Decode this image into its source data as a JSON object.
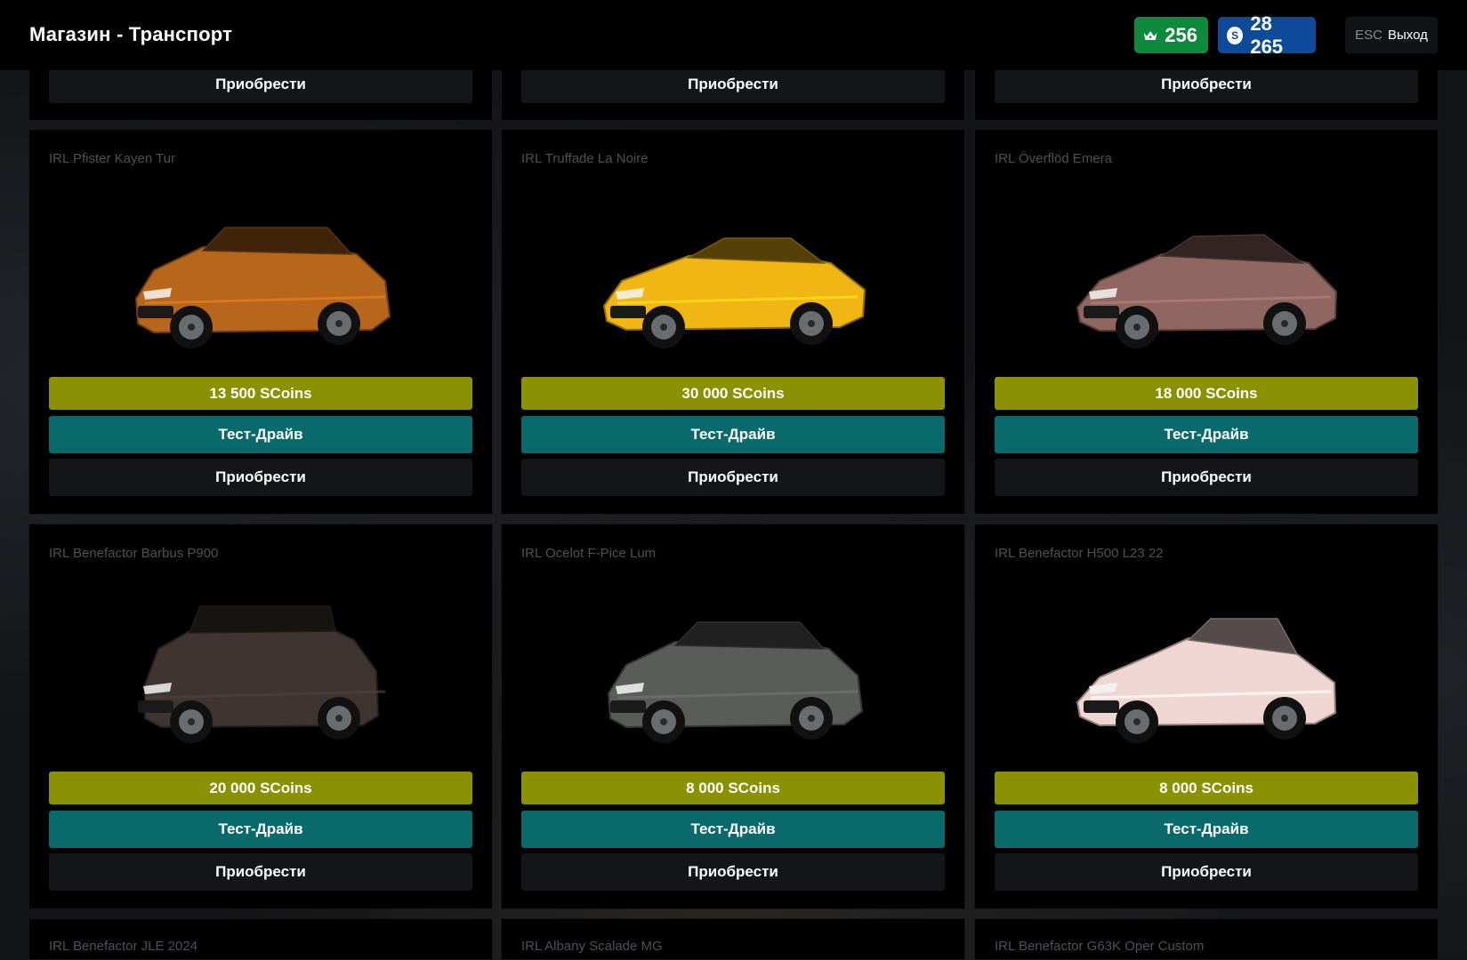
{
  "header": {
    "title": "Магазин - Транспорт",
    "crowns": "256",
    "coins": "28 265",
    "coin_symbol": "S",
    "exit_key": "ESC",
    "exit_label": "Выход"
  },
  "labels": {
    "buy": "Приобрести",
    "test_drive": "Тест-Драйв"
  },
  "colors": {
    "price_button": "#8a9102",
    "test_button": "#0a6a6b",
    "buy_button": "#141518",
    "crown_badge": "#0e8a3c",
    "coin_badge": "#0d4a99"
  },
  "cars": [
    {
      "name": "IRL Pfister Kayen Tur",
      "price": "13 500 SCoins",
      "body_color": "#b8661c",
      "shape": "suv"
    },
    {
      "name": "IRL Truffade La Noire",
      "price": "30 000 SCoins",
      "body_color": "#f2b614",
      "shape": "hyper"
    },
    {
      "name": "IRL Överflöd Emera",
      "price": "18 000 SCoins",
      "body_color": "#8f6660",
      "shape": "coupe"
    },
    {
      "name": "IRL Benefactor Barbus P900",
      "price": "20 000 SCoins",
      "body_color": "#3e3531",
      "shape": "box"
    },
    {
      "name": "IRL Ocelot F-Pice Lum",
      "price": "8 000 SCoins",
      "body_color": "#5a5c59",
      "shape": "suv"
    },
    {
      "name": "IRL Benefactor H500 L23 22",
      "price": "8 000 SCoins",
      "body_color": "#f0d6d2",
      "shape": "sedan"
    }
  ],
  "next_row": [
    {
      "name": "IRL Benefactor JLE 2024"
    },
    {
      "name": "IRL Albany Scalade MG"
    },
    {
      "name": "IRL Benefactor G63K Oper Custom"
    }
  ]
}
